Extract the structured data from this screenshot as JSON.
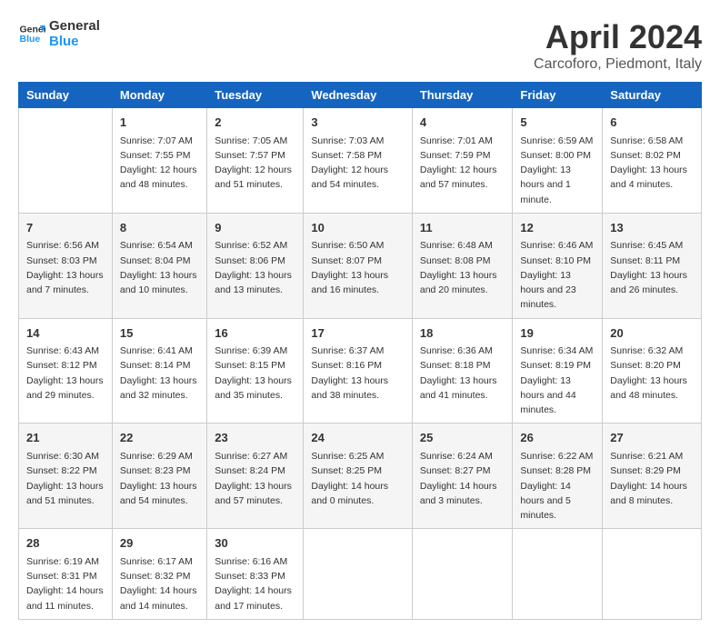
{
  "header": {
    "logo_line1": "General",
    "logo_line2": "Blue",
    "title": "April 2024",
    "subtitle": "Carcoforo, Piedmont, Italy"
  },
  "days_of_week": [
    "Sunday",
    "Monday",
    "Tuesday",
    "Wednesday",
    "Thursday",
    "Friday",
    "Saturday"
  ],
  "weeks": [
    [
      {
        "day": "",
        "info": ""
      },
      {
        "day": "1",
        "info": "Sunrise: 7:07 AM\nSunset: 7:55 PM\nDaylight: 12 hours and 48 minutes."
      },
      {
        "day": "2",
        "info": "Sunrise: 7:05 AM\nSunset: 7:57 PM\nDaylight: 12 hours and 51 minutes."
      },
      {
        "day": "3",
        "info": "Sunrise: 7:03 AM\nSunset: 7:58 PM\nDaylight: 12 hours and 54 minutes."
      },
      {
        "day": "4",
        "info": "Sunrise: 7:01 AM\nSunset: 7:59 PM\nDaylight: 12 hours and 57 minutes."
      },
      {
        "day": "5",
        "info": "Sunrise: 6:59 AM\nSunset: 8:00 PM\nDaylight: 13 hours and 1 minute."
      },
      {
        "day": "6",
        "info": "Sunrise: 6:58 AM\nSunset: 8:02 PM\nDaylight: 13 hours and 4 minutes."
      }
    ],
    [
      {
        "day": "7",
        "info": "Sunrise: 6:56 AM\nSunset: 8:03 PM\nDaylight: 13 hours and 7 minutes."
      },
      {
        "day": "8",
        "info": "Sunrise: 6:54 AM\nSunset: 8:04 PM\nDaylight: 13 hours and 10 minutes."
      },
      {
        "day": "9",
        "info": "Sunrise: 6:52 AM\nSunset: 8:06 PM\nDaylight: 13 hours and 13 minutes."
      },
      {
        "day": "10",
        "info": "Sunrise: 6:50 AM\nSunset: 8:07 PM\nDaylight: 13 hours and 16 minutes."
      },
      {
        "day": "11",
        "info": "Sunrise: 6:48 AM\nSunset: 8:08 PM\nDaylight: 13 hours and 20 minutes."
      },
      {
        "day": "12",
        "info": "Sunrise: 6:46 AM\nSunset: 8:10 PM\nDaylight: 13 hours and 23 minutes."
      },
      {
        "day": "13",
        "info": "Sunrise: 6:45 AM\nSunset: 8:11 PM\nDaylight: 13 hours and 26 minutes."
      }
    ],
    [
      {
        "day": "14",
        "info": "Sunrise: 6:43 AM\nSunset: 8:12 PM\nDaylight: 13 hours and 29 minutes."
      },
      {
        "day": "15",
        "info": "Sunrise: 6:41 AM\nSunset: 8:14 PM\nDaylight: 13 hours and 32 minutes."
      },
      {
        "day": "16",
        "info": "Sunrise: 6:39 AM\nSunset: 8:15 PM\nDaylight: 13 hours and 35 minutes."
      },
      {
        "day": "17",
        "info": "Sunrise: 6:37 AM\nSunset: 8:16 PM\nDaylight: 13 hours and 38 minutes."
      },
      {
        "day": "18",
        "info": "Sunrise: 6:36 AM\nSunset: 8:18 PM\nDaylight: 13 hours and 41 minutes."
      },
      {
        "day": "19",
        "info": "Sunrise: 6:34 AM\nSunset: 8:19 PM\nDaylight: 13 hours and 44 minutes."
      },
      {
        "day": "20",
        "info": "Sunrise: 6:32 AM\nSunset: 8:20 PM\nDaylight: 13 hours and 48 minutes."
      }
    ],
    [
      {
        "day": "21",
        "info": "Sunrise: 6:30 AM\nSunset: 8:22 PM\nDaylight: 13 hours and 51 minutes."
      },
      {
        "day": "22",
        "info": "Sunrise: 6:29 AM\nSunset: 8:23 PM\nDaylight: 13 hours and 54 minutes."
      },
      {
        "day": "23",
        "info": "Sunrise: 6:27 AM\nSunset: 8:24 PM\nDaylight: 13 hours and 57 minutes."
      },
      {
        "day": "24",
        "info": "Sunrise: 6:25 AM\nSunset: 8:25 PM\nDaylight: 14 hours and 0 minutes."
      },
      {
        "day": "25",
        "info": "Sunrise: 6:24 AM\nSunset: 8:27 PM\nDaylight: 14 hours and 3 minutes."
      },
      {
        "day": "26",
        "info": "Sunrise: 6:22 AM\nSunset: 8:28 PM\nDaylight: 14 hours and 5 minutes."
      },
      {
        "day": "27",
        "info": "Sunrise: 6:21 AM\nSunset: 8:29 PM\nDaylight: 14 hours and 8 minutes."
      }
    ],
    [
      {
        "day": "28",
        "info": "Sunrise: 6:19 AM\nSunset: 8:31 PM\nDaylight: 14 hours and 11 minutes."
      },
      {
        "day": "29",
        "info": "Sunrise: 6:17 AM\nSunset: 8:32 PM\nDaylight: 14 hours and 14 minutes."
      },
      {
        "day": "30",
        "info": "Sunrise: 6:16 AM\nSunset: 8:33 PM\nDaylight: 14 hours and 17 minutes."
      },
      {
        "day": "",
        "info": ""
      },
      {
        "day": "",
        "info": ""
      },
      {
        "day": "",
        "info": ""
      },
      {
        "day": "",
        "info": ""
      }
    ]
  ]
}
